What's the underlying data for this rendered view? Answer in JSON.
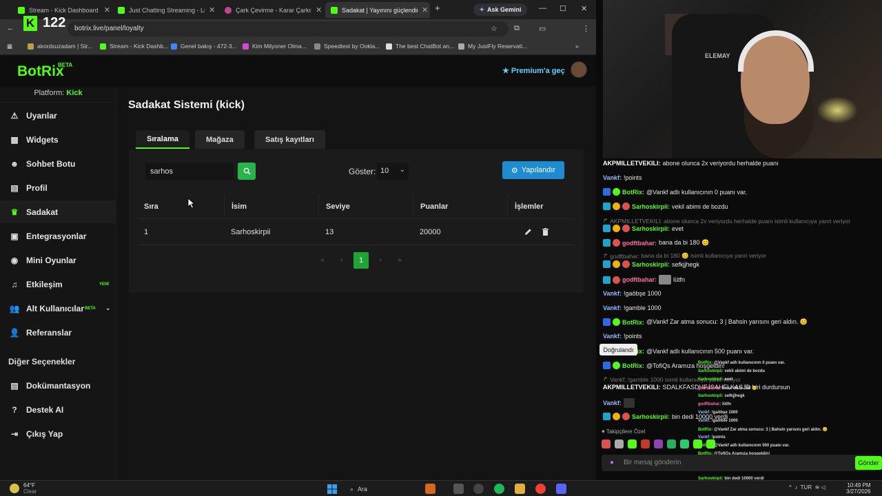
{
  "browser": {
    "tabs": [
      {
        "label": "Stream - Kick Dashboard",
        "color": "#53fc18"
      },
      {
        "label": "Just Chatting Streaming - Live",
        "color": "#53fc18"
      },
      {
        "label": "Çark Çevirme - Karar Çarkı!",
        "color": "#c0478a"
      },
      {
        "label": "Sadakat | Yayınını güçlendirme",
        "color": "#53fc18"
      }
    ],
    "ask_gemini": "Ask Gemini",
    "url": "botrix.live/panel/loyalty",
    "bookmarks": [
      {
        "label": "akordsuzadam | Str...",
        "color": "#b8a046"
      },
      {
        "label": "Stream - Kick Dashb...",
        "color": "#53fc18"
      },
      {
        "label": "Genel bakış - 472-3...",
        "color": "#4285f4"
      },
      {
        "label": "Kim Milyoner Olma...",
        "color": "#d04ad0"
      },
      {
        "label": "Speedtest by Ookla...",
        "color": "#888888"
      },
      {
        "label": "The best ChatBot an...",
        "color": "#dddddd"
      },
      {
        "label": "My JustFly Reservati...",
        "color": "#aaaaaa"
      }
    ],
    "kick_overlay_count": "122"
  },
  "app": {
    "logo": "BotRix",
    "logo_badge": "BETA",
    "premium": "Premium'a geç",
    "platform_label": "Platform:",
    "platform_value": "Kick",
    "nav": [
      {
        "label": "Uyarılar",
        "icon": "⚠"
      },
      {
        "label": "Widgets",
        "icon": "▦"
      },
      {
        "label": "Sohbet Botu",
        "icon": "☻"
      },
      {
        "label": "Profil",
        "icon": "▤"
      },
      {
        "label": "Sadakat",
        "icon": "♛"
      },
      {
        "label": "Entegrasyonlar",
        "icon": "▣"
      },
      {
        "label": "Mini Oyunlar",
        "icon": "◉"
      },
      {
        "label": "Etkileşim",
        "icon": "♫",
        "badge": "YENİ"
      },
      {
        "label": "Alt Kullanıcılar",
        "icon": "👥",
        "badge": "BETA"
      },
      {
        "label": "Referanslar",
        "icon": "👤"
      }
    ],
    "other_title": "Diğer Seçenekler",
    "other_nav": [
      {
        "label": "Dokümantasyon",
        "icon": "▤"
      },
      {
        "label": "Destek AI",
        "icon": "?"
      },
      {
        "label": "Çıkış Yap",
        "icon": "⇥"
      }
    ],
    "page_title": "Sadakat Sistemi (kick)",
    "tabs": [
      "Sıralama",
      "Mağaza",
      "Satış kayıtları"
    ],
    "search_value": "sarhos",
    "show_label": "Göster:",
    "show_value": "10",
    "configure": "Yapılandır",
    "table": {
      "headers": [
        "Sıra",
        "İsim",
        "Seviye",
        "Puanlar",
        "İşlemler"
      ],
      "rows": [
        {
          "rank": "1",
          "name": "Sarhoskirpii",
          "level": "13",
          "points": "20000"
        }
      ]
    },
    "pager": {
      "first": "«",
      "prev": "‹",
      "current": "1",
      "next": "›",
      "last": "»"
    }
  },
  "stream": {
    "chair_text": "ELEMAY",
    "chat": [
      {
        "user": "AKPMILLETVEKILI:",
        "text": "abone olunca 2x veriyordu herhalde puanı",
        "ucolor": "#ffffff"
      },
      {
        "user": "Vankf:",
        "text": "!points",
        "ucolor": "#9ab7ff"
      },
      {
        "user": "BotRix:",
        "text": "@Vankf adlı kullanıcının 0 puanı var.",
        "ucolor": "#53fc18"
      },
      {
        "user": "Sarhoskirpii:",
        "text": "vekil abimi de bozdu",
        "ucolor": "#53fc18"
      },
      {
        "user": "AKPMILLETVEKILI:",
        "text": "abone olunca 2x veriyordu herhalde puanı isimli kullanıcıya yanıt veriyor",
        "ucolor": "#777777"
      },
      {
        "user": "Sarhoskirpii:",
        "text": "evet",
        "ucolor": "#53fc18"
      },
      {
        "user": "godftbahar:",
        "text": "bana da bi 180 😊",
        "ucolor": "#ff6fa8"
      },
      {
        "user": "godftbahar:",
        "text": "bana da bi 180 😊 isimli kullanıcıya yanıt veriyor",
        "ucolor": "#777777"
      },
      {
        "user": "Sarhoskirpii:",
        "text": "sefkjjhegk",
        "ucolor": "#53fc18"
      },
      {
        "user": "godftbahar:",
        "text": "lütfn",
        "ucolor": "#ff6fa8"
      },
      {
        "user": "Vankf:",
        "text": "!gaöbşe 1000",
        "ucolor": "#9ab7ff"
      },
      {
        "user": "Vankf:",
        "text": "!gamble 1000",
        "ucolor": "#9ab7ff"
      },
      {
        "user": "BotRix:",
        "text": "@Vankf Zar atma sonucu: 3 | Bahsin yarısını geri aldın. 😊",
        "ucolor": "#53fc18"
      },
      {
        "user": "Vankf:",
        "text": "!points",
        "ucolor": "#9ab7ff"
      },
      {
        "user": "BotRix:",
        "text": "@Vankf adlı kullanıcının 500 puanı var.",
        "ucolor": "#53fc18"
      },
      {
        "user": "BotRix:",
        "text": "@TofiQs Aramıza hoşgeldin!",
        "ucolor": "#53fc18"
      },
      {
        "user": "Vankf:",
        "text": "!gamble 1000 isimli kullanıcıya yanıt veriyor",
        "ucolor": "#777777"
      },
      {
        "user": "AKPMILLETVEKILI:",
        "text": "SDALKFASDHFJSAHFLKASJD biri durdursun",
        "ucolor": "#ffffff"
      },
      {
        "user": "Vankf:",
        "text": "",
        "ucolor": "#9ab7ff"
      },
      {
        "user": "Sarhoskirpii:",
        "text": "bin dedi 10000 verdi",
        "ucolor": "#53fc18"
      }
    ],
    "tooltip": "Doğrulandı",
    "followers": "Takipçilere Özel",
    "input_placeholder": "Bir mesaj gönderin",
    "send": "Gönder"
  },
  "taskbar": {
    "temp": "64°F",
    "weather": "Clear",
    "search": "Ara",
    "lang": "TUR",
    "time": "10:49 PM",
    "date": "3/27/2026"
  }
}
